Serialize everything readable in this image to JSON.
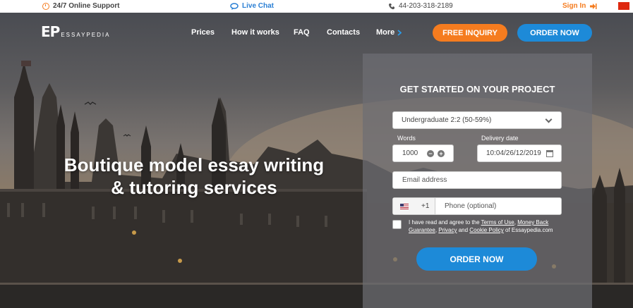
{
  "topbar": {
    "support": "24/7 Online Support",
    "live_chat": "Live Chat",
    "phone": "44-203-318-2189",
    "sign_in": "Sign In"
  },
  "nav": {
    "logo_mark": "EP",
    "logo_text": "ESSAYPEDIA",
    "links": [
      "Prices",
      "How it works",
      "FAQ",
      "Contacts",
      "More"
    ],
    "free_inquiry": "FREE INQUIRY",
    "order_now": "ORDER NOW"
  },
  "hero": {
    "headline_line1": "Boutique model essay writing",
    "headline_line2": "& tutoring services"
  },
  "form": {
    "title": "GET STARTED ON YOUR PROJECT",
    "level_value": "Undergraduate 2:2 (50-59%)",
    "words_label": "Words",
    "words_value": "1000",
    "delivery_label": "Delivery date",
    "delivery_value": "10:04/26/12/2019",
    "email_placeholder": "Email address",
    "phone_code": "+1",
    "phone_placeholder": "Phone (optional)",
    "terms_prefix": "I have read and agree to the ",
    "terms_of_use": "Terms of Use",
    "terms_sep1": ", ",
    "money_back": "Money Back Guarantee",
    "terms_sep2": ", ",
    "privacy": "Privacy",
    "terms_and": " and ",
    "cookie": "Cookie Policy",
    "terms_suffix": " of Essaypedia.com",
    "order_button": "ORDER NOW"
  },
  "colors": {
    "accent_orange": "#f57c1f",
    "accent_blue": "#1d8ad8"
  }
}
